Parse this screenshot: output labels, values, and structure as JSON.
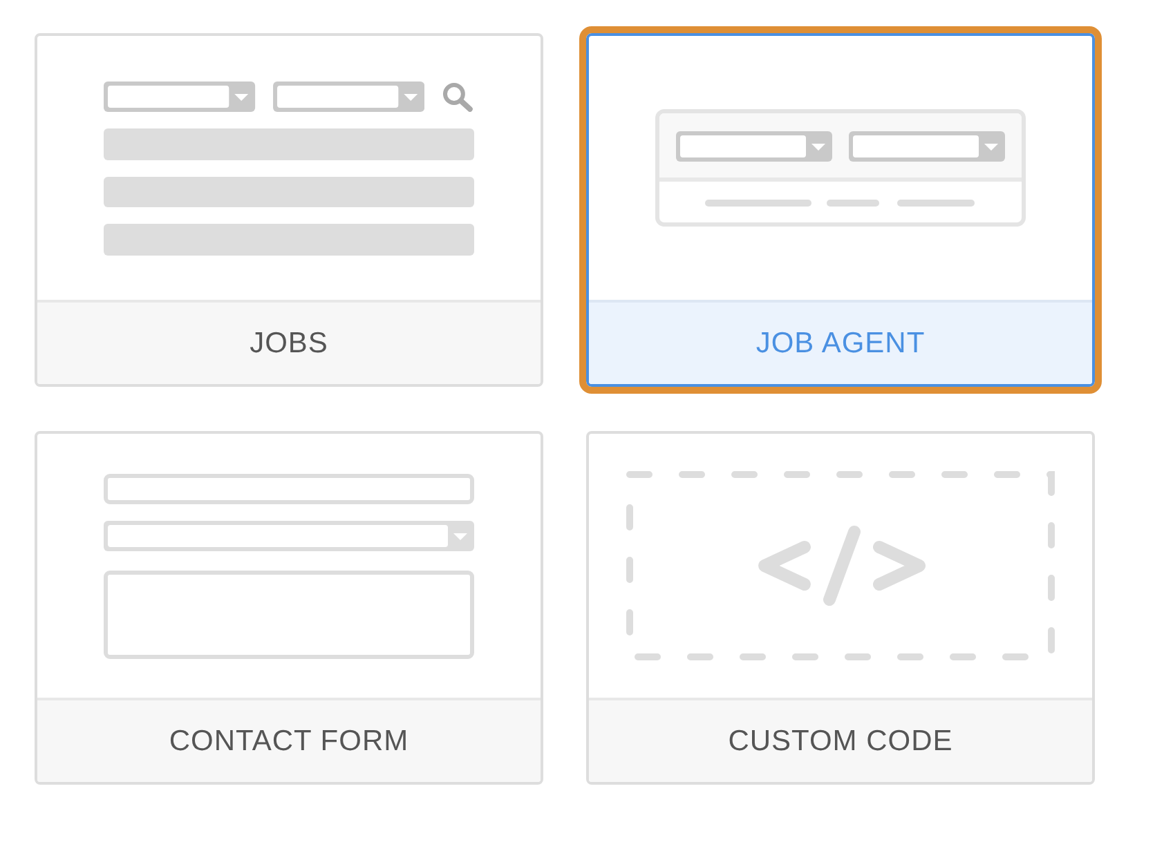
{
  "tiles": [
    {
      "kind": "jobs",
      "label": "JOBS",
      "selected": false
    },
    {
      "kind": "job_agent",
      "label": "JOB AGENT",
      "selected": true
    },
    {
      "kind": "contact_form",
      "label": "CONTACT FORM",
      "selected": false
    },
    {
      "kind": "custom_code",
      "label": "CUSTOM CODE",
      "selected": false
    }
  ]
}
